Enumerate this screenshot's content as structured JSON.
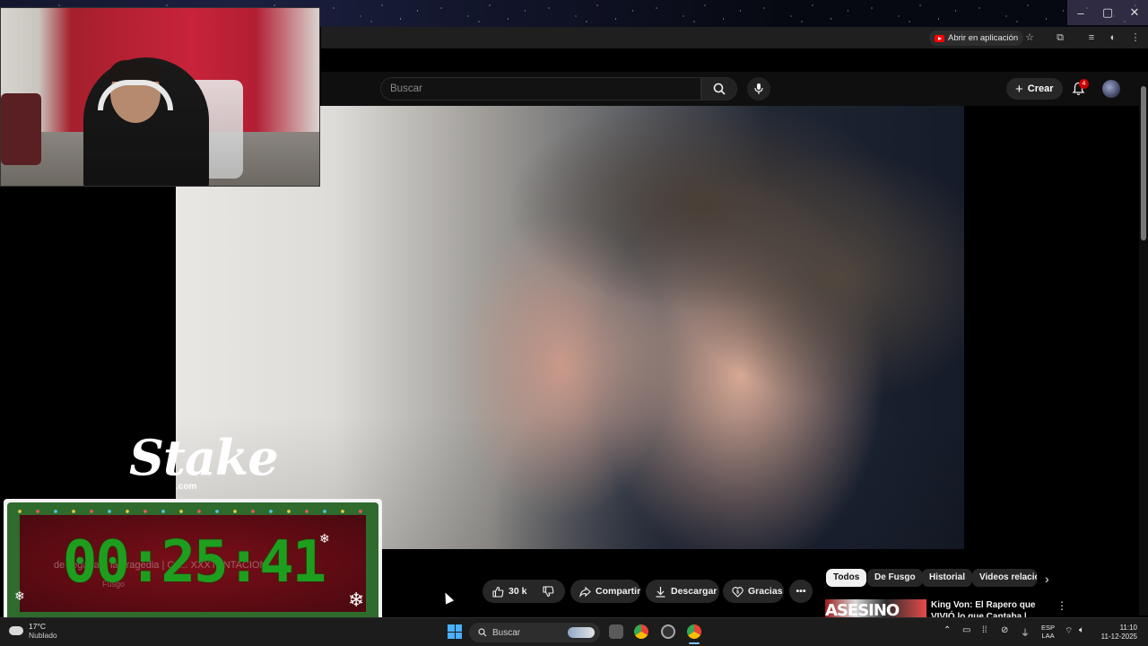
{
  "browser": {
    "open_in_app_label": "Abrir en aplicación",
    "icons": [
      "youtube-icon",
      "star-icon",
      "extensions-icon",
      "queue-icon",
      "profile-icon",
      "menu-kebab-icon"
    ],
    "window_controls": [
      "minimize",
      "maximize",
      "close"
    ]
  },
  "youtube_header": {
    "search_placeholder": "Buscar",
    "create_label": "Crear",
    "notifications_count": "4"
  },
  "overlay": {
    "brand": "Stake",
    "brand_suffix": ".com",
    "countdown": "00:25:41",
    "background_title": "de llegada a la Tragedia | Ca... XXXTENTACION",
    "background_channel": "Fusgo"
  },
  "video_actions": {
    "like_count": "30 k",
    "share_label": "Compartir",
    "download_label": "Descargar",
    "thanks_label": "Gracias"
  },
  "chips": [
    "Todos",
    "De Fusgo",
    "Historial",
    "Videos relacio"
  ],
  "recommendation": {
    "thumb_text": "ASESINO",
    "title": "King Von: El Rapero que VIVIÓ lo que Cantaba | Historia"
  },
  "taskbar": {
    "weather_temp": "17°C",
    "weather_desc": "Nublado",
    "search_label": "Buscar",
    "lang_line1": "ESP",
    "lang_line2": "LAA",
    "time": "11:10",
    "date": "11-12-2025"
  },
  "colors": {
    "youtube_bg": "#0f0f0f",
    "chip_active": "#f1f1f1",
    "countdown_green": "#1e9e1e",
    "notification_red": "#cc0000",
    "windows_blue": "#4ab0ff"
  }
}
